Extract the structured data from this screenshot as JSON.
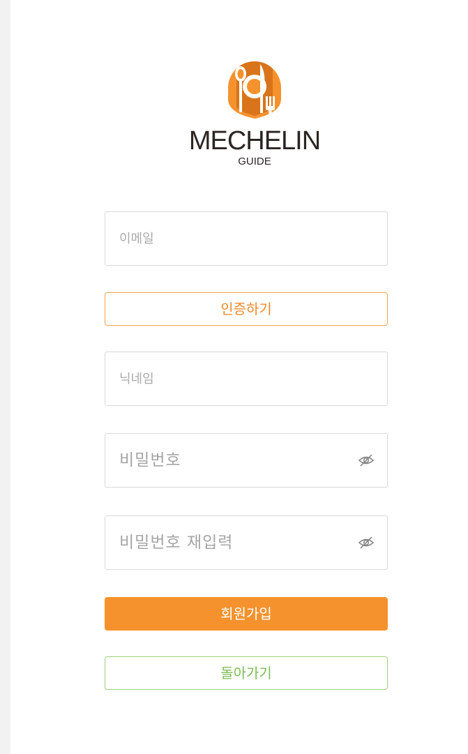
{
  "brand": {
    "name": "MECHELIN",
    "subtitle": "GUIDE",
    "accent_color": "#f6922d"
  },
  "form": {
    "email_placeholder": "이메일",
    "verify_button": "인증하기",
    "nickname_placeholder": "닉네임",
    "password_placeholder": "비밀번호",
    "password_confirm_placeholder": "비밀번호 재입력",
    "password_toggle_icon": "eye-off-icon",
    "signup_button": "회원가입",
    "back_button": "돌아가기"
  },
  "colors": {
    "primary": "#f6922d",
    "verify_border": "#f3a24a",
    "back_border": "#9fd07a",
    "back_text": "#7cbc52"
  }
}
